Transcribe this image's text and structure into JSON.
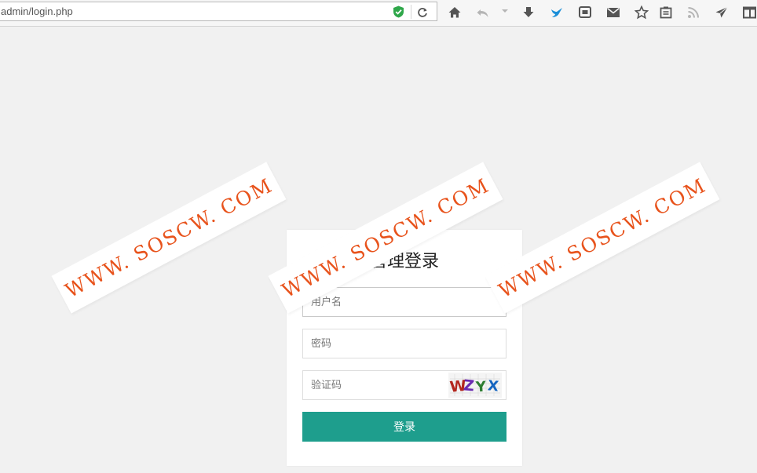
{
  "browser": {
    "url": "admin/login.php"
  },
  "login": {
    "title": "管理登录",
    "username_placeholder": "用户名",
    "password_placeholder": "密码",
    "captcha_placeholder": "验证码",
    "captcha_text": "WZYX",
    "submit_label": "登录"
  },
  "watermark": {
    "text": "WWW. SOSCW. COM"
  },
  "colors": {
    "accent": "#1e9e8d",
    "watermark": "#e8531c",
    "background": "#f1f1f1"
  },
  "icons": [
    "shield-icon",
    "reload-icon",
    "home-icon",
    "undo-icon",
    "dropdown-icon",
    "download-icon",
    "bird-icon",
    "screenshot-icon",
    "mail-icon",
    "star-icon",
    "clipboard-icon",
    "rss-icon",
    "send-icon",
    "window-icon"
  ]
}
